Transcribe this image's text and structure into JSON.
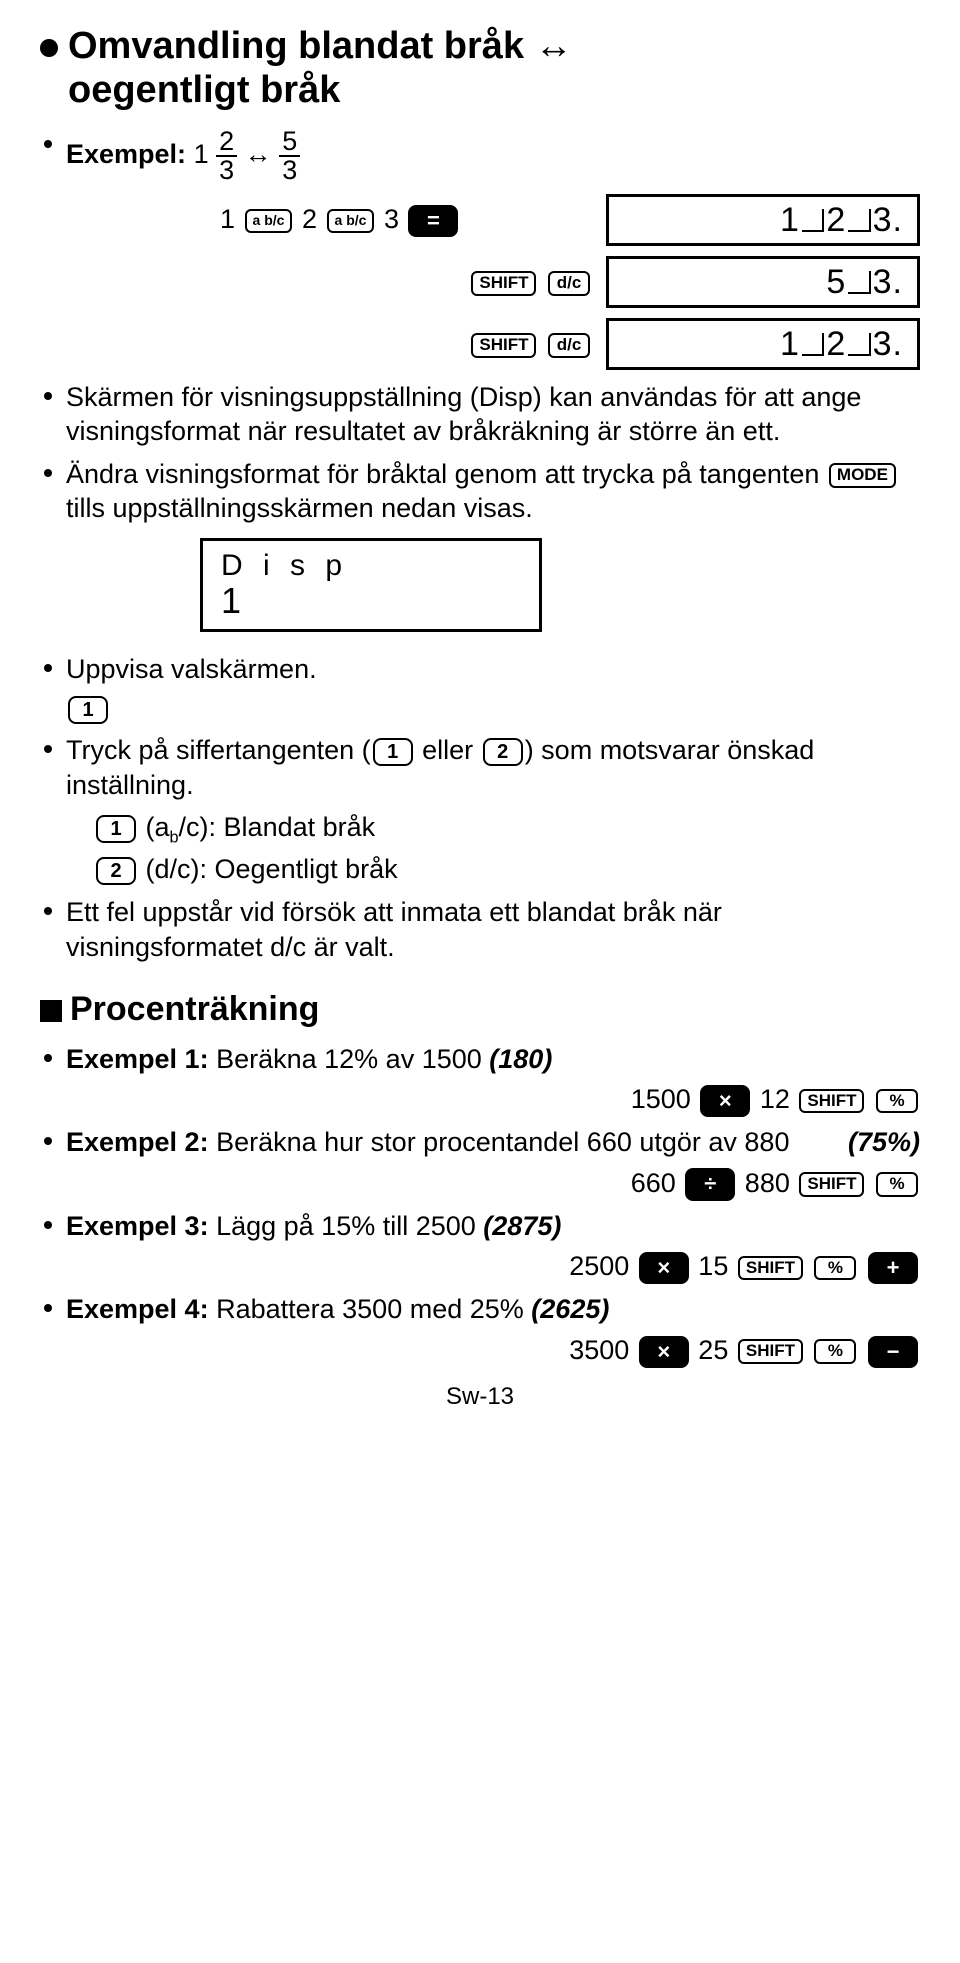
{
  "h1_line1": "Omvandling blandat bråk ↔",
  "h1_line2": "oegentligt bråk",
  "ex_label": "Exempel:",
  "ex_whole": "1",
  "fr1_n": "2",
  "fr1_d": "3",
  "arrow": "↔",
  "fr2_n": "5",
  "fr2_d": "3",
  "k_abc": "a b/c",
  "k_shift": "SHIFT",
  "k_dc": "d/c",
  "k_mode": "MODE",
  "k_eq": "=",
  "k_1": "1",
  "k_2": "2",
  "k_mul": "×",
  "k_div": "÷",
  "k_plus": "+",
  "k_minus": "−",
  "k_pct": "%",
  "seq1_a": "1",
  "seq1_b": "2",
  "seq1_c": "3",
  "disp1": "1  2  3.",
  "disp2": "5  3.",
  "disp3": "1  2  3.",
  "bul1": "Skärmen för visningsuppställning (Disp) kan användas för att ange visningsformat när resultatet av bråkräkning är större än ett.",
  "bul2a": "Ändra visningsformat för bråktal genom att trycka på tangenten ",
  "bul2b": " tills uppställningsskärmen nedan visas.",
  "disp_box_l1": "D i s p",
  "disp_box_l2": "1",
  "bul3": "Uppvisa valskärmen.",
  "bul4a": "Tryck på siffertangenten (",
  "bul4b": " eller ",
  "bul4c": ") som motsvarar önskad inställning.",
  "opt1_lbl": "(a",
  "opt1_lbl2": "b",
  "opt1_lbl3": "/c): Blandat bråk",
  "opt2_lbl": "(d/c): Oegentligt bråk",
  "bul5": "Ett fel uppstår vid försök att inmata ett blandat bråk när visningsformatet d/c är valt.",
  "h2": "Procenträkning",
  "pex1_lbl": "Exempel 1:",
  "pex1_txt": " Beräkna 12% av 1500 ",
  "pex1_res": "(180)",
  "pex1_sa": "1500",
  "pex1_sb": "12",
  "pex2_lbl": "Exempel 2:",
  "pex2_txt": " Beräkna hur stor procentandel 660 utgör av 880",
  "pex2_res": "(75%)",
  "pex2_sa": "660",
  "pex2_sb": "880",
  "pex3_lbl": "Exempel 3:",
  "pex3_txt": " Lägg på 15% till 2500 ",
  "pex3_res": "(2875)",
  "pex3_sa": "2500",
  "pex3_sb": "15",
  "pex4_lbl": "Exempel 4:",
  "pex4_txt": " Rabattera 3500 med 25% ",
  "pex4_res": "(2625)",
  "pex4_sa": "3500",
  "pex4_sb": "25",
  "footer": "Sw-13"
}
